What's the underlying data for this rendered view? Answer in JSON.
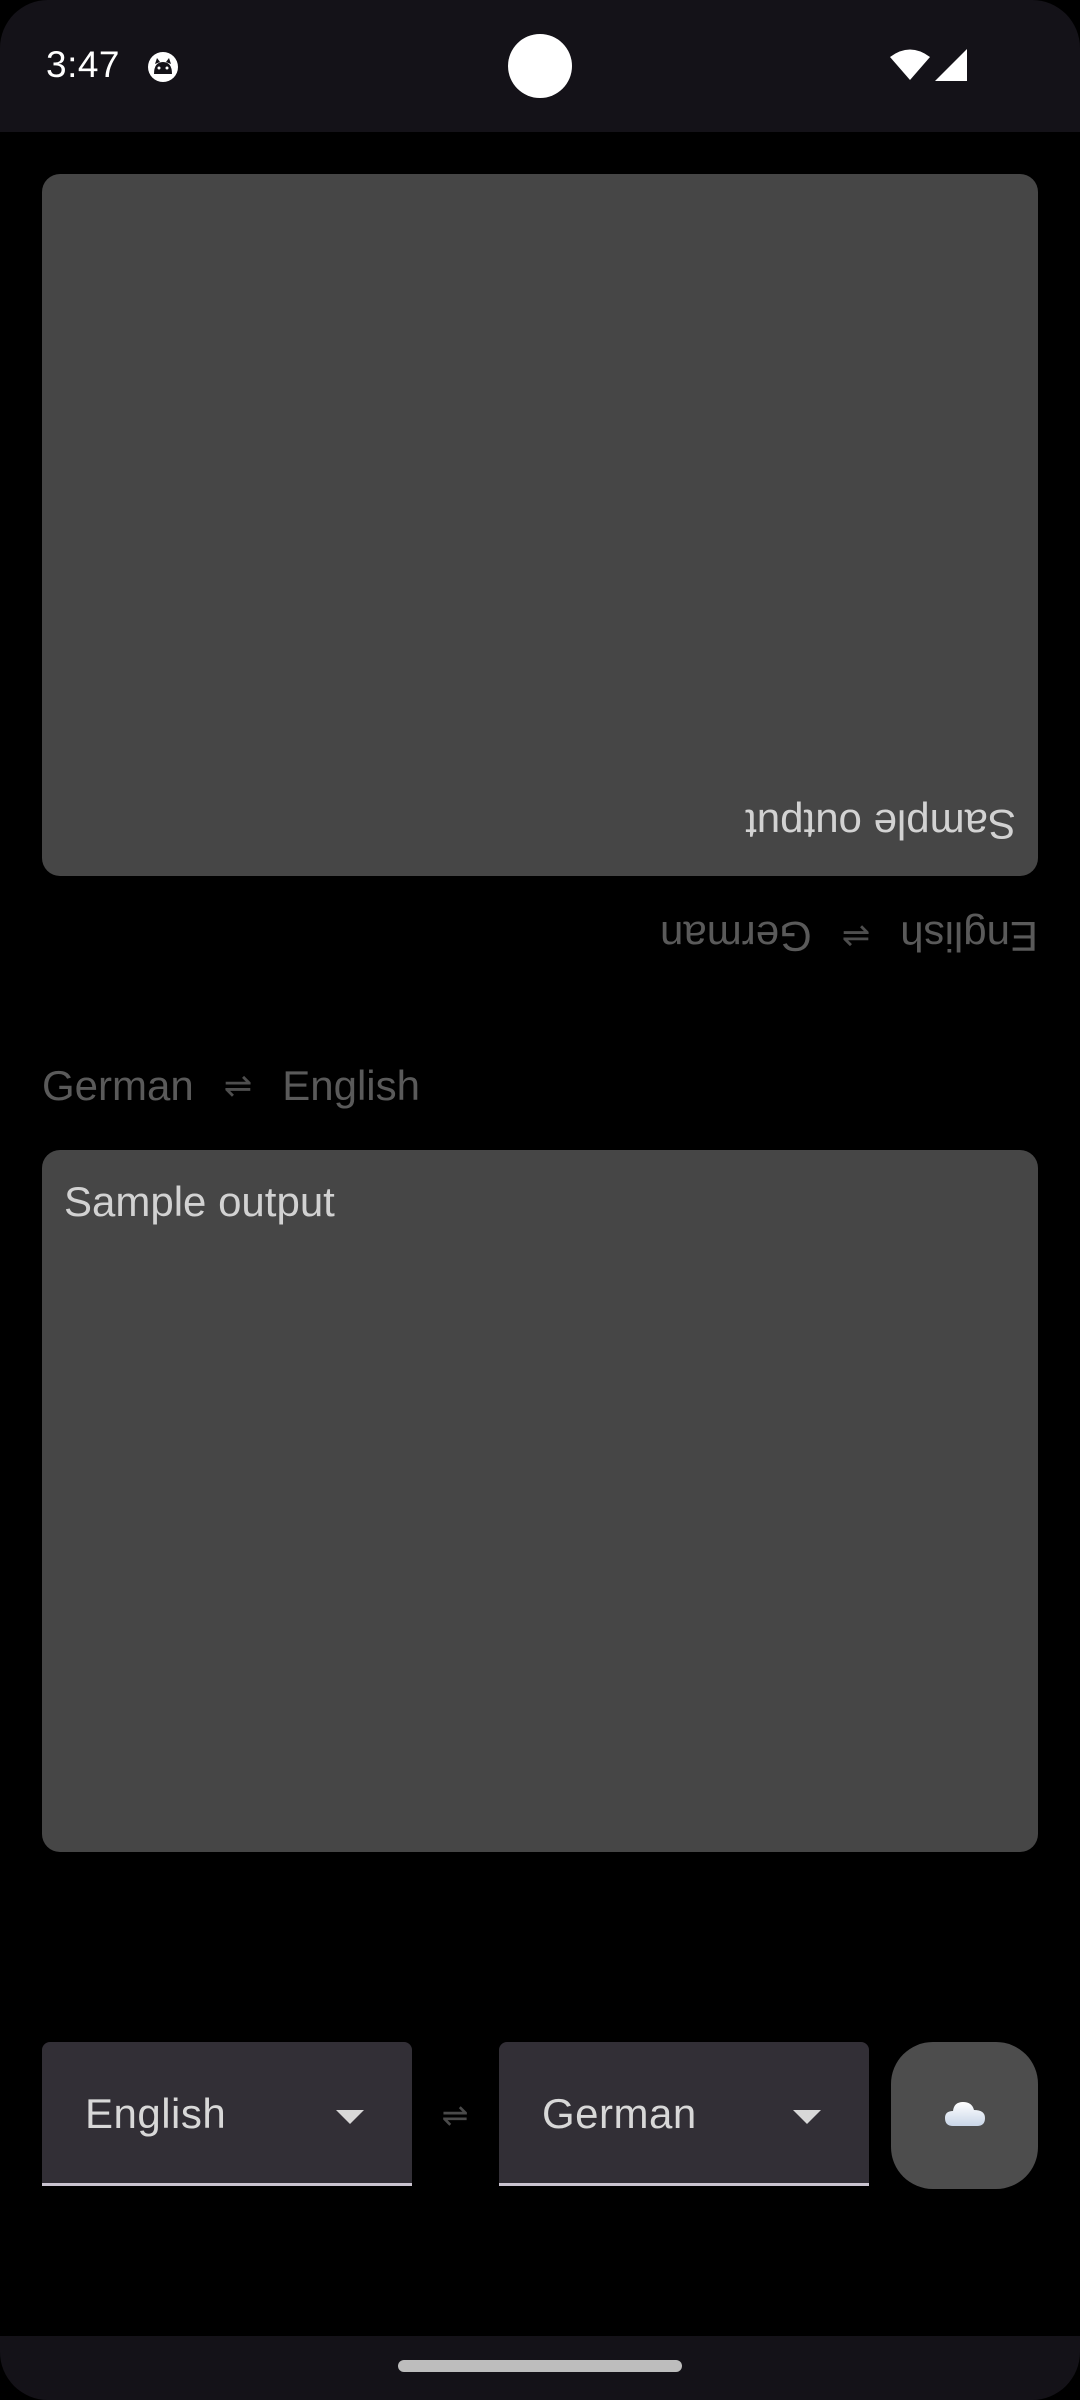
{
  "status_bar": {
    "time": "3:47",
    "notification_icon": "cat-icon",
    "wifi_icon": "wifi-icon",
    "signal_icon": "cellular-signal-icon"
  },
  "top_panel": {
    "orientation": "upside-down",
    "text": "Sample output",
    "language_row": {
      "source": "English",
      "separator": "⇌",
      "target": "German"
    }
  },
  "bottom_panel": {
    "text": "Sample output",
    "language_row": {
      "source": "German",
      "separator": "⇌",
      "target": "English"
    }
  },
  "controls": {
    "source_language": "English",
    "swap_symbol": "⇌",
    "target_language": "German",
    "action_icon": "cloud-icon"
  },
  "colors": {
    "background": "#000000",
    "panel": "#464646",
    "system_bar": "#141218",
    "select_background": "#322f36"
  }
}
